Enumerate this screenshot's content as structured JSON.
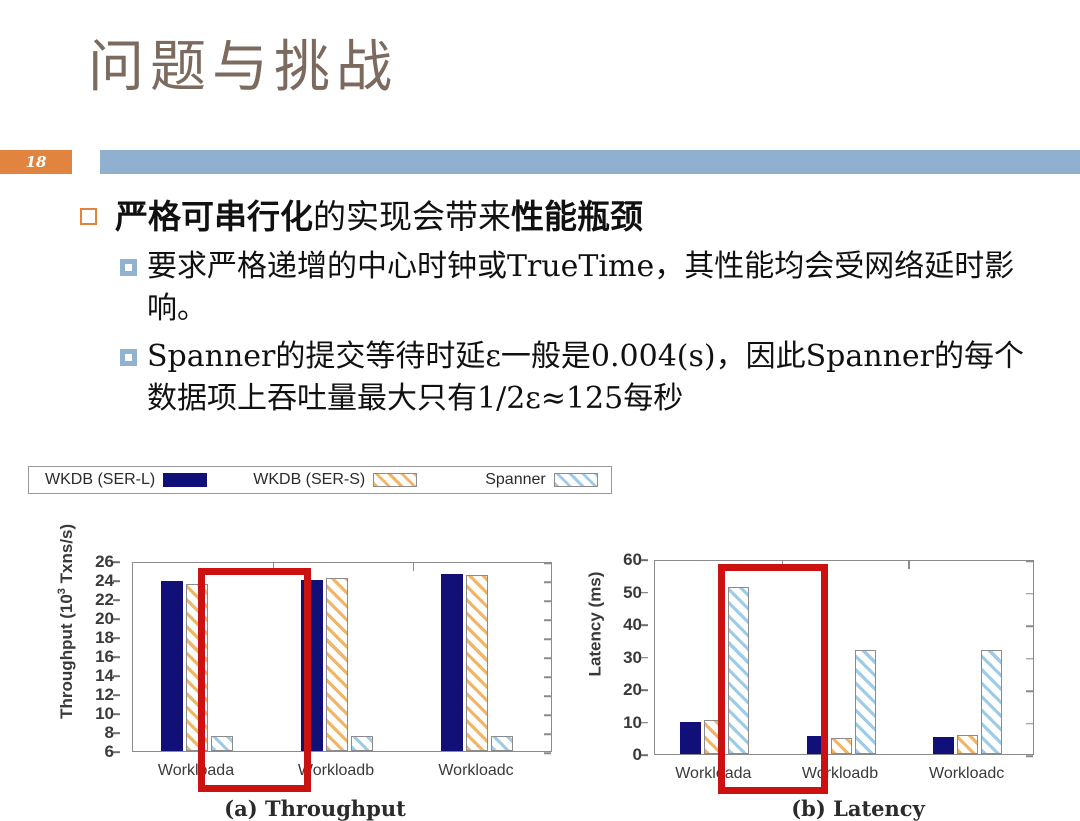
{
  "slide": {
    "title": "问题与挑战",
    "number": "18",
    "accent_orange": "#e08440",
    "band_blue": "#8fb0cf",
    "title_color": "#7d6a5f"
  },
  "bullets": {
    "level1": [
      {
        "bold_lead": "严格可串行化",
        "rest": "的实现会带来",
        "bold_tail": "性能瓶颈"
      }
    ],
    "level2": [
      {
        "text": "要求严格递增的中心时钟或TrueTime，其性能均会受网络延时影响。"
      },
      {
        "text": "Spanner的提交等待时延ε一般是0.004(s)，因此Spanner的每个数据项上吞吐量最大只有1/2ε≈125每秒"
      }
    ]
  },
  "figure": {
    "legend": [
      {
        "label": "WKDB (SER-L)",
        "swatch": "navy"
      },
      {
        "label": "WKDB (SER-S)",
        "swatch": "orange"
      },
      {
        "label": "Spanner",
        "swatch": "blue"
      }
    ],
    "captions": {
      "left": "(a) Throughput",
      "right": "(b) Latency"
    },
    "highlight_color": "#cc1111",
    "highlight_group": "Workloada"
  },
  "chart_data": [
    {
      "type": "bar",
      "title": "(a) Throughput",
      "xlabel": "",
      "ylabel": "Throughput (10³ Txns/s)",
      "ylim": [
        6,
        26
      ],
      "yticks": [
        6,
        8,
        10,
        12,
        14,
        16,
        18,
        20,
        22,
        24,
        26
      ],
      "grid": false,
      "legend": "top, outside",
      "categories": [
        "Workloada",
        "Workloadb",
        "Workloadc"
      ],
      "series": [
        {
          "name": "WKDB (SER-L)",
          "color": "#101078",
          "values": [
            23.9,
            24.0,
            24.6
          ]
        },
        {
          "name": "WKDB (SER-S)",
          "color": "#f2b465",
          "values": [
            23.6,
            24.2,
            24.5
          ]
        },
        {
          "name": "Spanner",
          "color": "#9ecbe8",
          "values": [
            7.6,
            7.6,
            7.6
          ]
        }
      ],
      "annotations": [
        {
          "type": "rect",
          "label": "red highlight box",
          "covers": "Workloada"
        }
      ]
    },
    {
      "type": "bar",
      "title": "(b) Latency",
      "xlabel": "",
      "ylabel": "Latency (ms)",
      "ylim": [
        0,
        60
      ],
      "yticks": [
        0,
        10,
        20,
        30,
        40,
        50,
        60
      ],
      "grid": false,
      "legend": "top, outside",
      "categories": [
        "Workloada",
        "Workloadb",
        "Workloadc"
      ],
      "series": [
        {
          "name": "WKDB (SER-L)",
          "color": "#101078",
          "values": [
            9.7,
            5.6,
            5.3
          ]
        },
        {
          "name": "WKDB (SER-S)",
          "color": "#f2b465",
          "values": [
            10.5,
            5.0,
            5.7
          ]
        },
        {
          "name": "Spanner",
          "color": "#9ecbe8",
          "values": [
            51.3,
            32.0,
            32.0
          ]
        }
      ],
      "annotations": [
        {
          "type": "rect",
          "label": "red highlight box",
          "covers": "Workloada"
        }
      ]
    }
  ]
}
